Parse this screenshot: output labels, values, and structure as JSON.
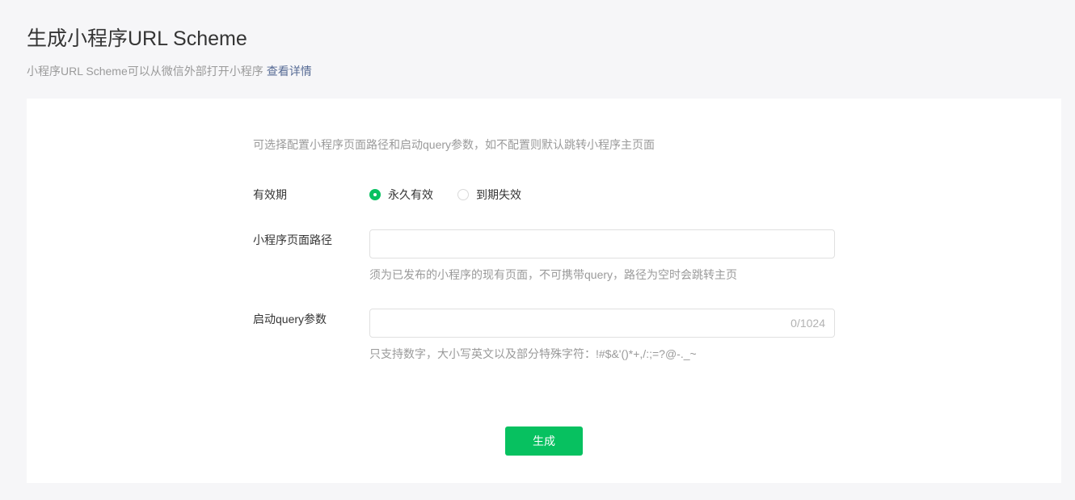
{
  "header": {
    "title": "生成小程序URL Scheme",
    "description": "小程序URL Scheme可以从微信外部打开小程序",
    "details_link": "查看详情"
  },
  "form": {
    "tip": "可选择配置小程序页面路径和启动query参数，如不配置则默认跳转小程序主页面",
    "validity": {
      "label": "有效期",
      "options": [
        {
          "label": "永久有效",
          "checked": true
        },
        {
          "label": "到期失效",
          "checked": false
        }
      ]
    },
    "page_path": {
      "label": "小程序页面路径",
      "value": "",
      "placeholder": "",
      "hint": "须为已发布的小程序的现有页面，不可携带query，路径为空时会跳转主页"
    },
    "query": {
      "label": "启动query参数",
      "value": "",
      "placeholder": "",
      "counter": "0/1024",
      "hint": "只支持数字，大小写英文以及部分特殊字符：!#$&'()*+,/:;=?@-._~"
    },
    "submit_label": "生成"
  },
  "colors": {
    "accent": "#07c160",
    "link": "#576b95",
    "page_background": "#f6f6f8"
  }
}
